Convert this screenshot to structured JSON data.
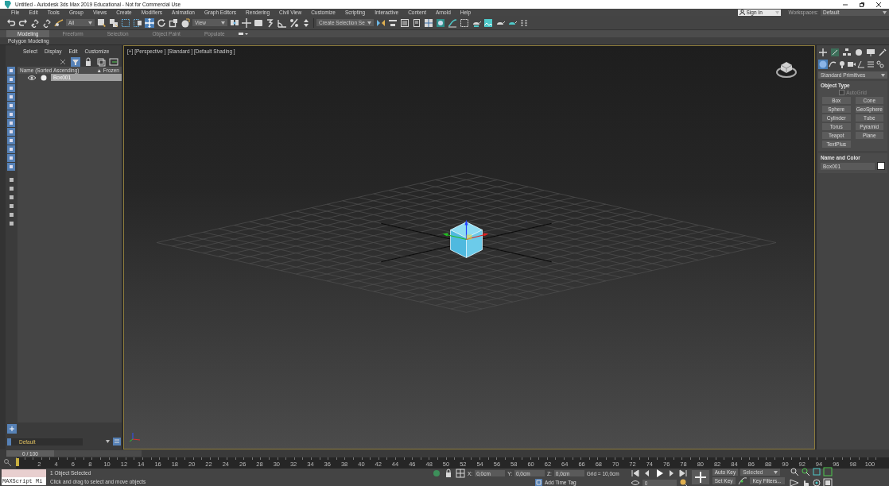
{
  "window": {
    "title": "Untitled - Autodesk 3ds Max 2019 Educational - Not for Commercial Use"
  },
  "menu": [
    "File",
    "Edit",
    "Tools",
    "Group",
    "Views",
    "Create",
    "Modifiers",
    "Animation",
    "Graph Editors",
    "Rendering",
    "Civil View",
    "Customize",
    "Scripting",
    "Interactive",
    "Content",
    "Arnold",
    "Help"
  ],
  "account": {
    "sign_in": "Sign In",
    "workspaces_label": "Workspaces:",
    "workspace": "Default"
  },
  "toolbar": {
    "selection_filter": "All",
    "reference_coord": "View",
    "named_selection": "Create Selection Se"
  },
  "ribbon": {
    "tabs": [
      {
        "label": "Modeling",
        "selected": true
      },
      {
        "label": "Freeform",
        "selected": false
      },
      {
        "label": "Selection",
        "selected": false
      },
      {
        "label": "Object Paint",
        "selected": false
      },
      {
        "label": "Populate",
        "selected": false
      }
    ],
    "panel": "Polygon Modeling"
  },
  "scene_explorer": {
    "menu": [
      "Select",
      "Display",
      "Edit",
      "Customize"
    ],
    "columns": [
      "Name (Sorted Ascending)",
      "▲ Frozen"
    ],
    "rows": [
      {
        "name": "Box001",
        "selected": true
      }
    ],
    "layer": "Default"
  },
  "viewport": {
    "label": "[+] [Perspective ] [Standard ] [Default Shading ]"
  },
  "command_panel": {
    "category": "Standard Primitives",
    "object_type": {
      "title": "Object Type",
      "autogrid": {
        "label": "AutoGrid",
        "checked": false
      },
      "buttons": [
        "Box",
        "Cone",
        "Sphere",
        "GeoSphere",
        "Cylinder",
        "Tube",
        "Torus",
        "Pyramid",
        "Teapot",
        "Plane",
        "TextPlus"
      ]
    },
    "name_and_color": {
      "title": "Name and Color",
      "name": "Box001",
      "color": "#ffffff"
    }
  },
  "time_slider": {
    "reading": "0 / 100",
    "level": 0
  },
  "track_bar": {
    "ticks": [
      "2",
      "4",
      "6",
      "8",
      "10",
      "12",
      "14",
      "16",
      "18",
      "20",
      "22",
      "24",
      "26",
      "28",
      "30",
      "32",
      "34",
      "36",
      "38",
      "40",
      "42",
      "44",
      "46",
      "48",
      "50",
      "52",
      "54",
      "56",
      "58",
      "60",
      "62",
      "64",
      "66",
      "68",
      "70",
      "72",
      "74",
      "76",
      "78",
      "80",
      "82",
      "84",
      "86",
      "88",
      "90",
      "92",
      "94",
      "96",
      "98",
      "100"
    ]
  },
  "status": {
    "listener": "MAXScript Mi",
    "selection": "1 Object Selected",
    "prompt": "Click and drag to select and move objects"
  },
  "coordinates": {
    "fields": [
      {
        "label": "X:",
        "value": "0,0cm"
      },
      {
        "label": "Y:",
        "value": "0,0cm"
      },
      {
        "label": "Z:",
        "value": "0,0cm"
      }
    ],
    "grid": "Grid = 10,0cm",
    "time_tag": "Add Time Tag"
  },
  "playback": {
    "frame": "0"
  },
  "keys": {
    "auto_key": "Auto Key",
    "key_mode": "Selected",
    "set_key": "Set Key",
    "key_filters": "Key Filters..."
  }
}
